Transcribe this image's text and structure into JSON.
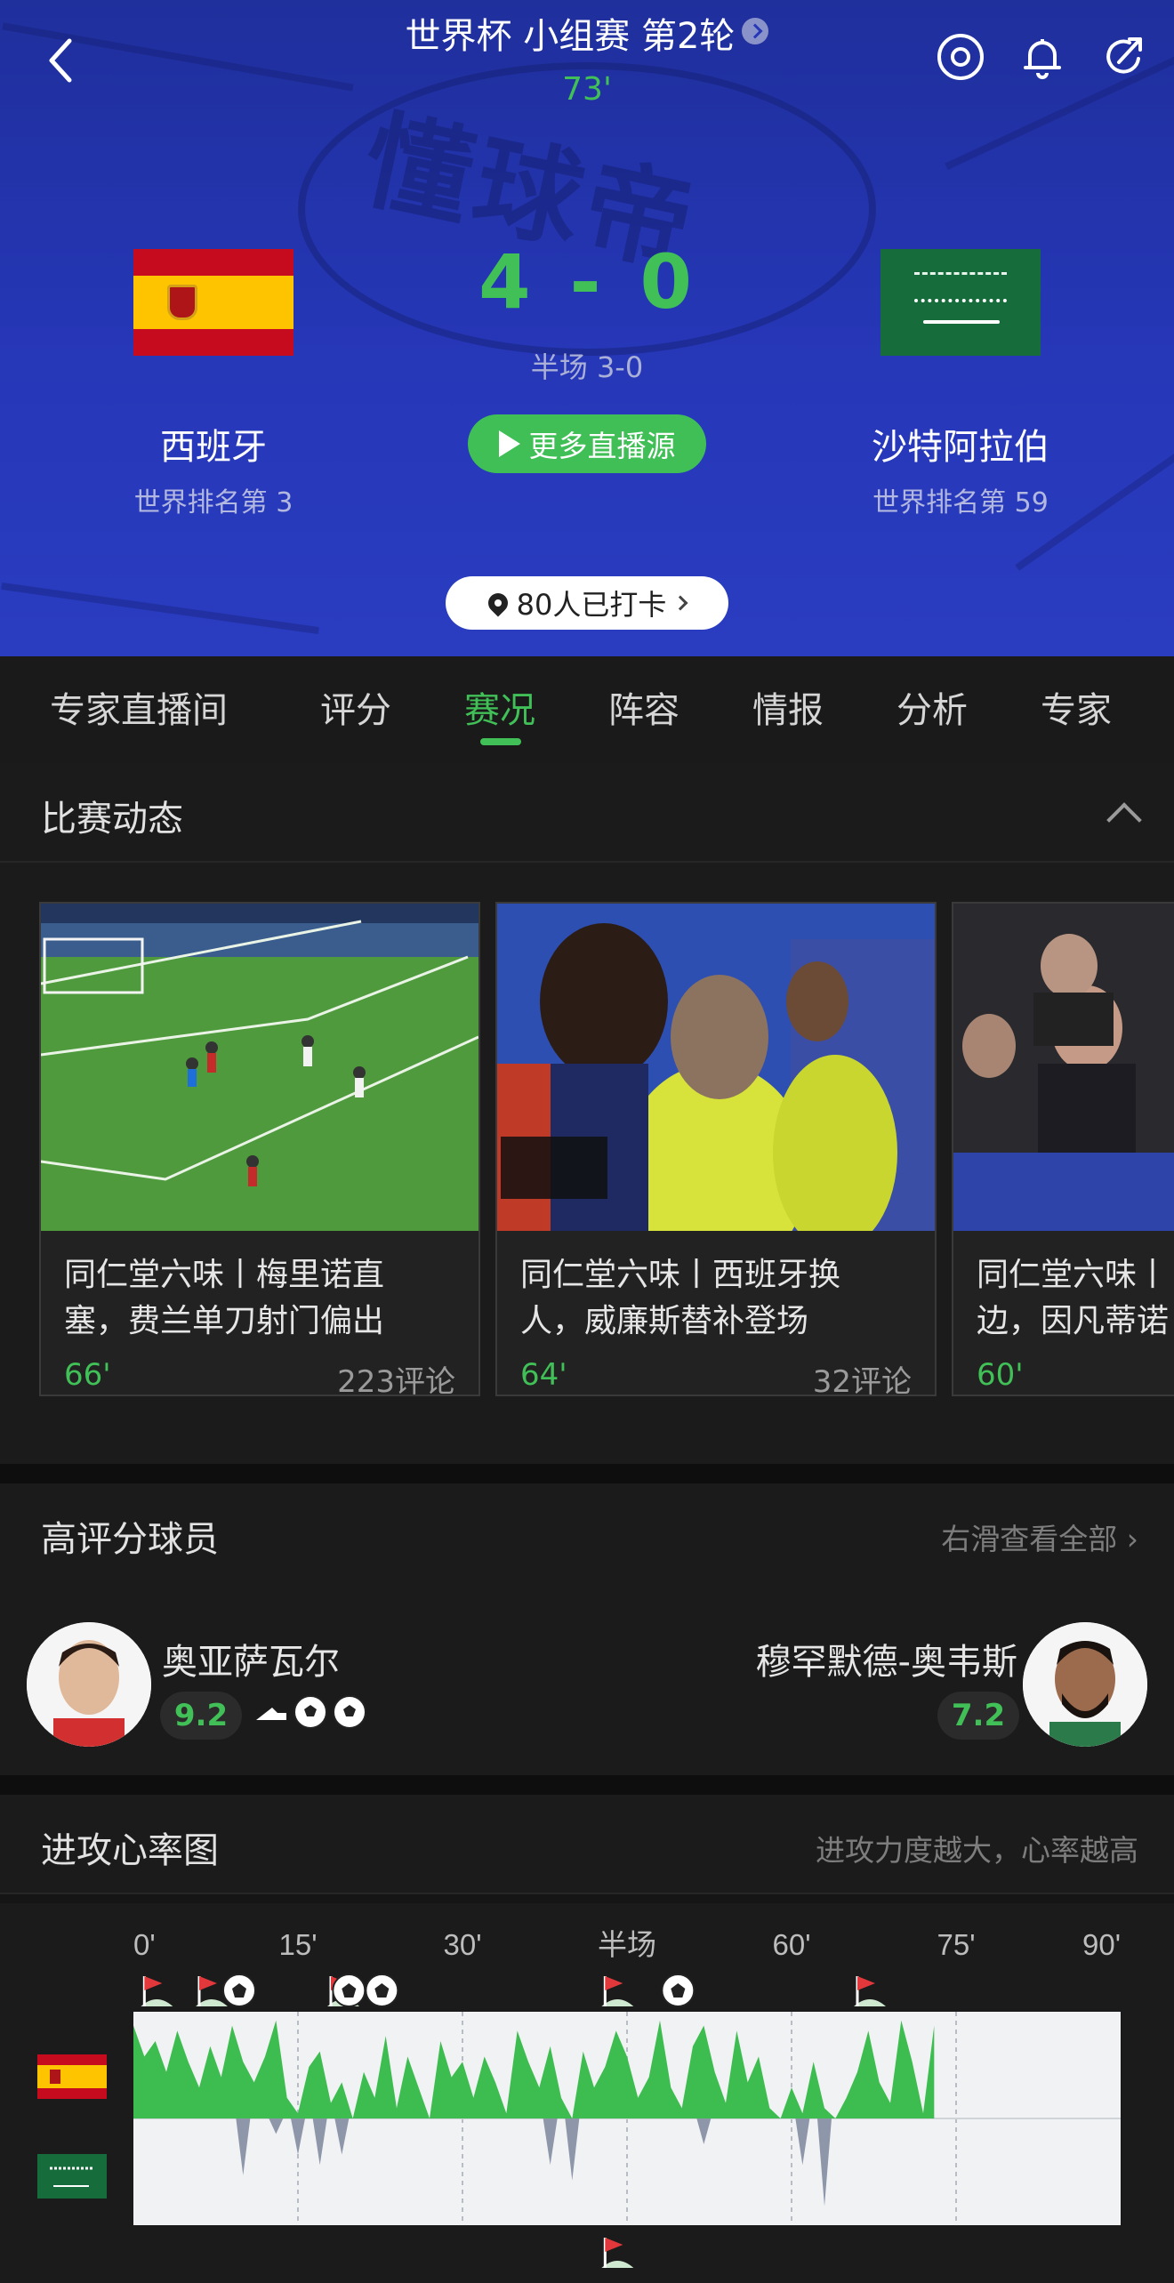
{
  "header": {
    "competition": "世界杯 小组赛 第2轮",
    "minute": "73'",
    "score_home": "4",
    "score_sep": "-",
    "score_away": "0",
    "half_time": "半场 3-0",
    "live_button": "更多直播源",
    "checkin": "80人已打卡",
    "watermark": "懂球帝",
    "home": {
      "name": "西班牙",
      "rank": "世界排名第 3"
    },
    "away": {
      "name": "沙特阿拉伯",
      "rank": "世界排名第 59"
    },
    "icons": [
      "back-icon",
      "target-icon",
      "bell-icon",
      "share-icon"
    ]
  },
  "tabs": [
    {
      "label": "专家直播间"
    },
    {
      "label": "评分"
    },
    {
      "label": "赛况",
      "active": true
    },
    {
      "label": "阵容"
    },
    {
      "label": "情报"
    },
    {
      "label": "分析"
    },
    {
      "label": "专家"
    }
  ],
  "match_events": {
    "title": "比赛动态",
    "cards": [
      {
        "title": "同仁堂六味丨梅里诺直\n塞，费兰单刀射门偏出",
        "minute": "66'",
        "comments": "223评论"
      },
      {
        "title": "同仁堂六味丨西班牙换\n人，威廉斯替补登场",
        "minute": "64'",
        "comments": "32评论"
      },
      {
        "title": "同仁堂六味丨\n边，因凡蒂诺",
        "minute": "60'",
        "comments": ""
      }
    ]
  },
  "top_players": {
    "title": "高评分球员",
    "more": "右滑查看全部",
    "home": {
      "name": "奥亚萨瓦尔",
      "rating": "9.2",
      "events": [
        "assist-boot-icon",
        "goal-ball-icon",
        "goal-ball-icon"
      ]
    },
    "away": {
      "name": "穆罕默德-奥韦斯",
      "rating": "7.2"
    }
  },
  "attack_chart": {
    "title": "进攻心率图",
    "subtitle": "进攻力度越大，心率越高"
  },
  "chart_data": {
    "type": "area",
    "x_ticks": [
      "0'",
      "15'",
      "30'",
      "半场",
      "60'",
      "75'",
      "90'"
    ],
    "xlim": [
      0,
      90
    ],
    "current_minute": 73,
    "series": [
      {
        "name": "西班牙",
        "color": "#3dbd4f",
        "direction": "up",
        "x": [
          0,
          1,
          2,
          3,
          4,
          5,
          6,
          7,
          8,
          9,
          10,
          11,
          12,
          13,
          14,
          15,
          16,
          17,
          18,
          19,
          20,
          21,
          22,
          23,
          24,
          25,
          26,
          27,
          28,
          29,
          30,
          31,
          32,
          33,
          34,
          35,
          36,
          37,
          38,
          39,
          40,
          41,
          42,
          43,
          44,
          45,
          46,
          47,
          48,
          49,
          50,
          51,
          52,
          53,
          54,
          55,
          56,
          57,
          58,
          59,
          60,
          61,
          62,
          63,
          64,
          65,
          66,
          67,
          68,
          69,
          70,
          71,
          72,
          73
        ],
        "values": [
          0.9,
          0.6,
          0.75,
          0.45,
          0.85,
          0.55,
          0.3,
          0.7,
          0.4,
          0.9,
          0.55,
          0.35,
          0.6,
          0.95,
          0.2,
          0.05,
          0.5,
          0.65,
          0.15,
          0.35,
          0.0,
          0.45,
          0.2,
          0.8,
          0.1,
          0.6,
          0.3,
          0.0,
          0.75,
          0.4,
          0.55,
          0.2,
          0.6,
          0.35,
          0.05,
          0.85,
          0.55,
          0.3,
          0.7,
          0.2,
          0.0,
          0.65,
          0.3,
          0.5,
          0.85,
          0.6,
          0.2,
          0.4,
          0.95,
          0.3,
          0.1,
          0.7,
          0.9,
          0.45,
          0.15,
          0.85,
          0.35,
          0.6,
          0.1,
          0.0,
          0.3,
          0.05,
          0.55,
          0.1,
          0.0,
          0.2,
          0.45,
          0.85,
          0.35,
          0.15,
          0.95,
          0.55,
          0.05,
          0.9
        ]
      },
      {
        "name": "沙特阿拉伯",
        "color": "#8e96aa",
        "direction": "down",
        "x": [
          10,
          13,
          15,
          17,
          19,
          38,
          40,
          52,
          61,
          63
        ],
        "values": [
          0.55,
          0.15,
          0.35,
          0.45,
          0.35,
          0.45,
          0.6,
          0.25,
          0.45,
          0.85
        ]
      }
    ],
    "events_home": [
      {
        "minute": 1,
        "type": "corner"
      },
      {
        "minute": 6,
        "type": "corner"
      },
      {
        "minute": 9,
        "type": "goal"
      },
      {
        "minute": 18,
        "type": "corner"
      },
      {
        "minute": 19,
        "type": "goal"
      },
      {
        "minute": 22,
        "type": "goal"
      },
      {
        "minute": 43,
        "type": "corner"
      },
      {
        "minute": 49,
        "type": "goal"
      },
      {
        "minute": 66,
        "type": "corner"
      }
    ],
    "events_away": [
      {
        "minute": 43,
        "type": "corner"
      }
    ]
  }
}
